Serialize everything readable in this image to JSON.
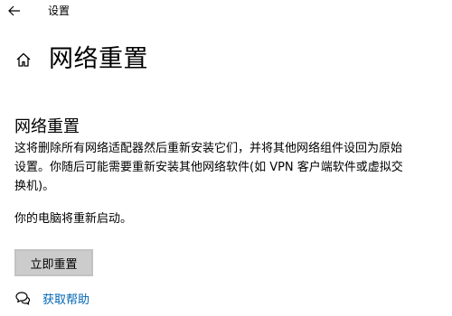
{
  "window": {
    "back_icon": "arrow-left-icon",
    "app_title": "设置"
  },
  "header": {
    "home_icon": "home-icon",
    "title": "网络重置"
  },
  "section": {
    "title": "网络重置",
    "description": "这将删除所有网络适配器然后重新安装它们，并将其他网络组件设回为原始设置。你随后可能需要重新安装其他网络软件(如 VPN 客户端软件或虚拟交换机)。",
    "restart_note": "你的电脑将重新启动。",
    "reset_button_label": "立即重置"
  },
  "help": {
    "icon": "chat-bubbles-icon",
    "link_label": "获取帮助"
  },
  "colors": {
    "background": "#ffffff",
    "text": "#000000",
    "button_bg": "#cccccc",
    "link": "#0066b4"
  }
}
